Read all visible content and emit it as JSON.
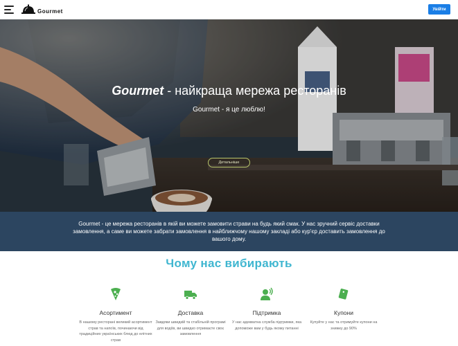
{
  "header": {
    "logo_text": "Gourmet",
    "login_label": "Увійти",
    "accent_color": "#1a7ee6"
  },
  "hero": {
    "title_brand": "Gourmet",
    "title_rest": " - найкраща мережа ресторанів",
    "subtitle": "Gourmet - я це люблю!",
    "details_label": "Детальніше"
  },
  "info": {
    "text": "Gourmet - це мережа ресторанів в якій ви можете замовити страви на будь який смак. У нас зручний сервіс доставки замовлення, а саме ви можете забрати замовлення в найближчому нашому закладі або кур'єр доставить замовлення до вашого дому."
  },
  "why": {
    "title": "Чому нас вибирають",
    "title_color": "#3fb6d0",
    "icon_color": "#4caf50",
    "features": [
      {
        "icon": "pizza-slice-icon",
        "title": "Асортимент",
        "desc": "В нашому ресторані великий асортимент страв та напоїв, починаючи від традиційних українських блюд до елітних страв"
      },
      {
        "icon": "truck-icon",
        "title": "Доставка",
        "desc": "Завдяки швидкій та стабільній програмі для водіїв, ви швидко отримаєте своє замовлення"
      },
      {
        "icon": "support-agent-icon",
        "title": "Підтримка",
        "desc": "У нас адекватна служба підтримки, яка допоможе вам у будь якому питанні"
      },
      {
        "icon": "coupon-icon",
        "title": "Купони",
        "desc": "Купуйте у нас та отримуйте купони на знижку до 90%"
      }
    ]
  }
}
